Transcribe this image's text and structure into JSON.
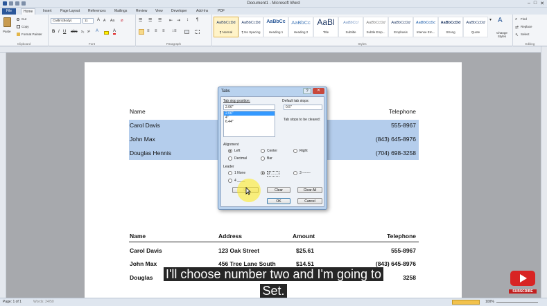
{
  "window": {
    "title": "Document1 - Microsoft Word"
  },
  "tabs": [
    {
      "label": "File"
    },
    {
      "label": "Home"
    },
    {
      "label": "Insert"
    },
    {
      "label": "Page Layout"
    },
    {
      "label": "References"
    },
    {
      "label": "Mailings"
    },
    {
      "label": "Review"
    },
    {
      "label": "View"
    },
    {
      "label": "Developer"
    },
    {
      "label": "Add-Ins"
    },
    {
      "label": "PDF"
    }
  ],
  "ribbon": {
    "clipboard": {
      "paste": "Paste",
      "cut": "Cut",
      "copy": "Copy",
      "format_painter": "Format Painter",
      "label": "Clipboard"
    },
    "font": {
      "name": "Calibri (Body)",
      "size": "11",
      "label": "Font"
    },
    "paragraph": {
      "label": "Paragraph"
    },
    "styles": {
      "label": "Styles",
      "items": [
        {
          "sample": "AaBbCcDd",
          "name": "¶ Normal"
        },
        {
          "sample": "AaBbCcDd",
          "name": "¶ No Spacing"
        },
        {
          "sample": "AaBbCc",
          "name": "Heading 1"
        },
        {
          "sample": "AaBbCc",
          "name": "Heading 2"
        },
        {
          "sample": "AaBl",
          "name": "Title"
        },
        {
          "sample": "AaBbCcI",
          "name": "Subtitle"
        },
        {
          "sample": "AaBbCcDd",
          "name": "Subtle Emp..."
        },
        {
          "sample": "AaBbCcDd",
          "name": "Emphasis"
        },
        {
          "sample": "AaBbCcDc",
          "name": "Intense Em..."
        },
        {
          "sample": "AaBbCcDd",
          "name": "Strong"
        },
        {
          "sample": "AaBbCcDd",
          "name": "Quote"
        }
      ],
      "change_styles": "Change Styles"
    },
    "editing": {
      "find": "Find",
      "replace": "Replace",
      "select": "Select",
      "label": "Editing"
    }
  },
  "document": {
    "top_table": {
      "headers": {
        "name": "Name",
        "telephone": "Telephone"
      },
      "rows": [
        {
          "name": "Carol Davis",
          "phone": "555-8967"
        },
        {
          "name": "John Max",
          "phone": "(843) 645-8976"
        },
        {
          "name": "Douglas Hennis",
          "phone": "(704) 698-3258"
        }
      ]
    },
    "bottom_table": {
      "headers": [
        "Name",
        "Address",
        "Amount",
        "Telephone"
      ],
      "rows": [
        [
          "Carol Davis",
          "123 Oak Street",
          "$25.61",
          "555-8967"
        ],
        [
          "John Max",
          "456 Tree Lane South",
          "$14.51",
          "(843) 645-8976"
        ],
        [
          "Douglas",
          "",
          "",
          "3258"
        ]
      ]
    }
  },
  "dialog": {
    "title": "Tabs",
    "tab_stop_label": "Tab stop position:",
    "tab_stop_value": "2.06\"",
    "tab_stops": [
      {
        "v": "2.06\"",
        "sel": true
      },
      {
        "v": "4\"",
        "sel": false
      },
      {
        "v": "6.44\"",
        "sel": false
      }
    ],
    "default_label": "Default tab stops:",
    "default_value": "0.5\"",
    "cleared_label": "Tab stops to be cleared:",
    "alignment_label": "Alignment",
    "alignments": [
      "Left",
      "Center",
      "Right",
      "Decimal",
      "Bar"
    ],
    "leader_label": "Leader",
    "leaders": [
      "1 None",
      "2 .......",
      "3 -------",
      "4 ____"
    ],
    "buttons": {
      "set": "Set",
      "clear": "Clear",
      "clear_all": "Clear All",
      "ok": "OK",
      "cancel": "Cancel"
    }
  },
  "status": {
    "page": "Page: 1 of 1",
    "words": "Words: 24/50",
    "zoom": "100%"
  },
  "caption": {
    "line1": "I'll choose number two and I'm going to",
    "line2": "Set."
  },
  "overlay": {
    "subscribe": "SUBSCRIBE"
  }
}
